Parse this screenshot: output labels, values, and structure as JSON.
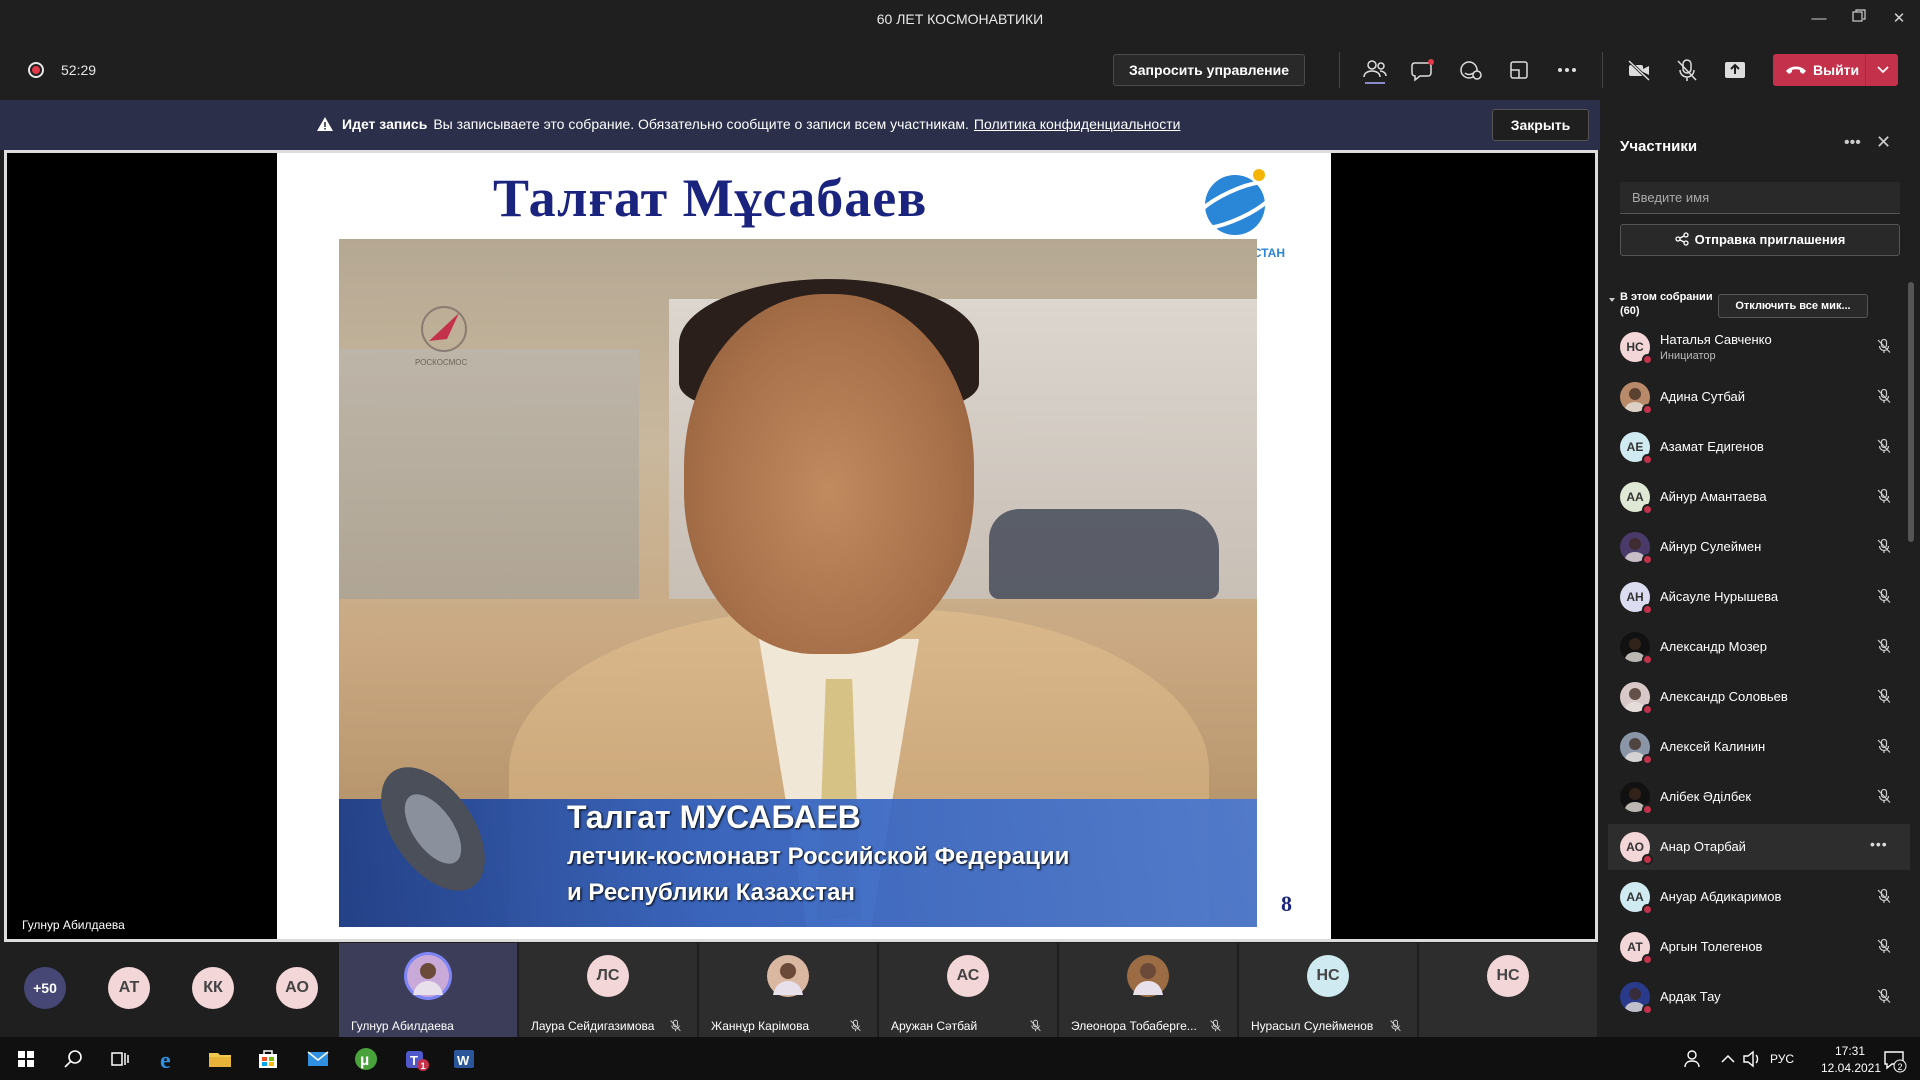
{
  "window": {
    "title": "60 ЛЕТ КОСМОНАВТИКИ"
  },
  "toolbar": {
    "timer": "52:29",
    "request_control": "Запросить управление",
    "leave": "Выйти"
  },
  "banner": {
    "bold": "Идет запись",
    "text": "Вы записываете это собрание. Обязательно сообщите о записи всем участникам.",
    "link": "Политика конфиденциальности",
    "close": "Закрыть"
  },
  "slide": {
    "title": "Талғат Мұсабаев",
    "caption_name": "Талгат МУСАБАЕВ",
    "caption_line1": "летчик-космонавт Российской Федерации",
    "caption_line2": "и Республики Казахстан",
    "page_number": "8",
    "logo_text": "РОСКОСМОС",
    "globe_text": "КАЗАХСТАН"
  },
  "stage": {
    "presenter_name": "Гулнур Абилдаева"
  },
  "strip": {
    "overflow": "+50",
    "small_avatars": [
      {
        "initials": "АТ",
        "bg": "#f3d6d8"
      },
      {
        "initials": "КК",
        "bg": "#f3d6d8"
      },
      {
        "initials": "АО",
        "bg": "#f3d6d8"
      }
    ],
    "tiles": [
      {
        "name": "Гулнур Абилдаева",
        "initials": "",
        "bg": "#c8a9d8",
        "active": true,
        "muted": false,
        "photo": true
      },
      {
        "name": "Лаура Сейдигазимова",
        "initials": "ЛС",
        "bg": "#f3d6d8",
        "active": false,
        "muted": true
      },
      {
        "name": "Жаннұр Карімова",
        "initials": "",
        "bg": "#d9b7a0",
        "active": false,
        "muted": true,
        "photo": true
      },
      {
        "name": "Аружан Сәтбай",
        "initials": "АС",
        "bg": "#f3d6d8",
        "active": false,
        "muted": true
      },
      {
        "name": "Элеонора Тобаберге...",
        "initials": "",
        "bg": "#9c6d45",
        "active": false,
        "muted": true,
        "photo": true
      },
      {
        "name": "Нурасыл Сулейменов",
        "initials": "НС",
        "bg": "#cfeaf0",
        "active": false,
        "muted": true
      },
      {
        "name": "",
        "initials": "НС",
        "bg": "#f3d6d8",
        "active": false,
        "muted": false
      }
    ]
  },
  "panel": {
    "title": "Участники",
    "search_placeholder": "Введите имя",
    "invite": "Отправка приглашения",
    "section_label": "В этом собрании",
    "section_count": "(60)",
    "mute_all": "Отключить все мик...",
    "participants": [
      {
        "name": "Наталья Савченко",
        "role": "Инициатор",
        "initials": "НС",
        "bg": "#f3d6d8"
      },
      {
        "name": "Адина Сутбай",
        "role": "",
        "initials": "",
        "bg": "#b98a6a",
        "photo": true
      },
      {
        "name": "Азамат Едигенов",
        "role": "",
        "initials": "АЕ",
        "bg": "#cfeaf0"
      },
      {
        "name": "Айнур Амантаева",
        "role": "",
        "initials": "АА",
        "bg": "#dfe8d4"
      },
      {
        "name": "Айнур Сулеймен",
        "role": "",
        "initials": "",
        "bg": "#4a3a6a",
        "photo": true
      },
      {
        "name": "Айсауле Нурышева",
        "role": "",
        "initials": "АН",
        "bg": "#dcdcf0"
      },
      {
        "name": "Александр Мозер",
        "role": "",
        "initials": "",
        "bg": "#111111",
        "photo": true
      },
      {
        "name": "Александр Соловьев",
        "role": "",
        "initials": "",
        "bg": "#d8c8c8",
        "photo": true
      },
      {
        "name": "Алексей Калинин",
        "role": "",
        "initials": "",
        "bg": "#8a96a8",
        "photo": true
      },
      {
        "name": "Алібек Әділбек",
        "role": "",
        "initials": "",
        "bg": "#111111",
        "photo": true
      },
      {
        "name": "Анар Отарбай",
        "role": "",
        "initials": "АО",
        "bg": "#f3d6d8",
        "hover": true
      },
      {
        "name": "Ануар Абдикаримов",
        "role": "",
        "initials": "АА",
        "bg": "#cfeaf0"
      },
      {
        "name": "Аргын Толегенов",
        "role": "",
        "initials": "АТ",
        "bg": "#f3d6d8"
      },
      {
        "name": "Ардак Тау",
        "role": "",
        "initials": "",
        "bg": "#2a3a8a",
        "photo": true
      }
    ]
  },
  "taskbar": {
    "language": "РУС",
    "time": "17:31",
    "date": "12.04.2021",
    "notifications": "2",
    "teams_badge": "1"
  },
  "colors": {
    "leave": "#c4314b",
    "banner": "#2b2f4a",
    "active_tile": "#3c3d59",
    "status_busy": "#c4314b"
  }
}
